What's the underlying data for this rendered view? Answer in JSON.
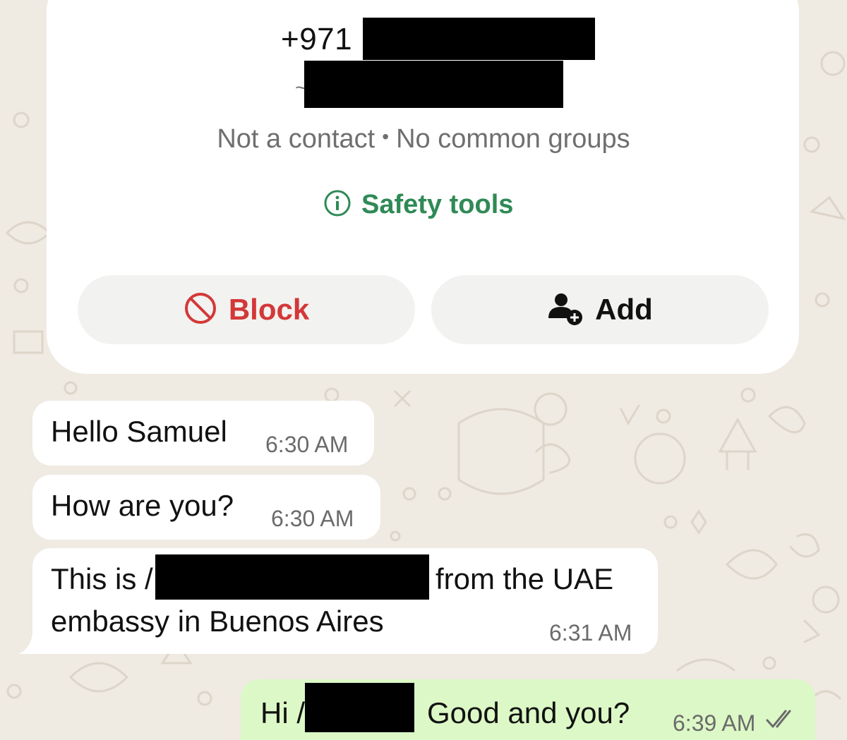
{
  "contact": {
    "phone_prefix": "+971",
    "tilde": "~",
    "meta_left": "Not a contact",
    "meta_sep": "•",
    "meta_right": "No common groups",
    "safety_label": "Safety tools",
    "block_label": "Block",
    "add_label": "Add"
  },
  "messages": [
    {
      "text": "Hello Samuel",
      "time": "6:30 AM",
      "direction": "incoming"
    },
    {
      "text": "How are you?",
      "time": "6:30 AM",
      "direction": "incoming"
    },
    {
      "text_start": "This is /",
      "text_mid": "from the UAE",
      "text_line2": "embassy in Buenos Aires",
      "time": "6:31 AM",
      "direction": "incoming"
    },
    {
      "text_start": "Hi /",
      "text_mid": "Good and you?",
      "time": "6:39 AM",
      "direction": "outgoing",
      "status": "read"
    }
  ],
  "colors": {
    "background": "#efeae2",
    "accent_green": "#2f8a56",
    "block_red": "#d33838",
    "outgoing_bubble": "#dcf8c6"
  },
  "icons": [
    "info-icon",
    "block-icon",
    "add-contact-icon",
    "double-check-icon"
  ]
}
